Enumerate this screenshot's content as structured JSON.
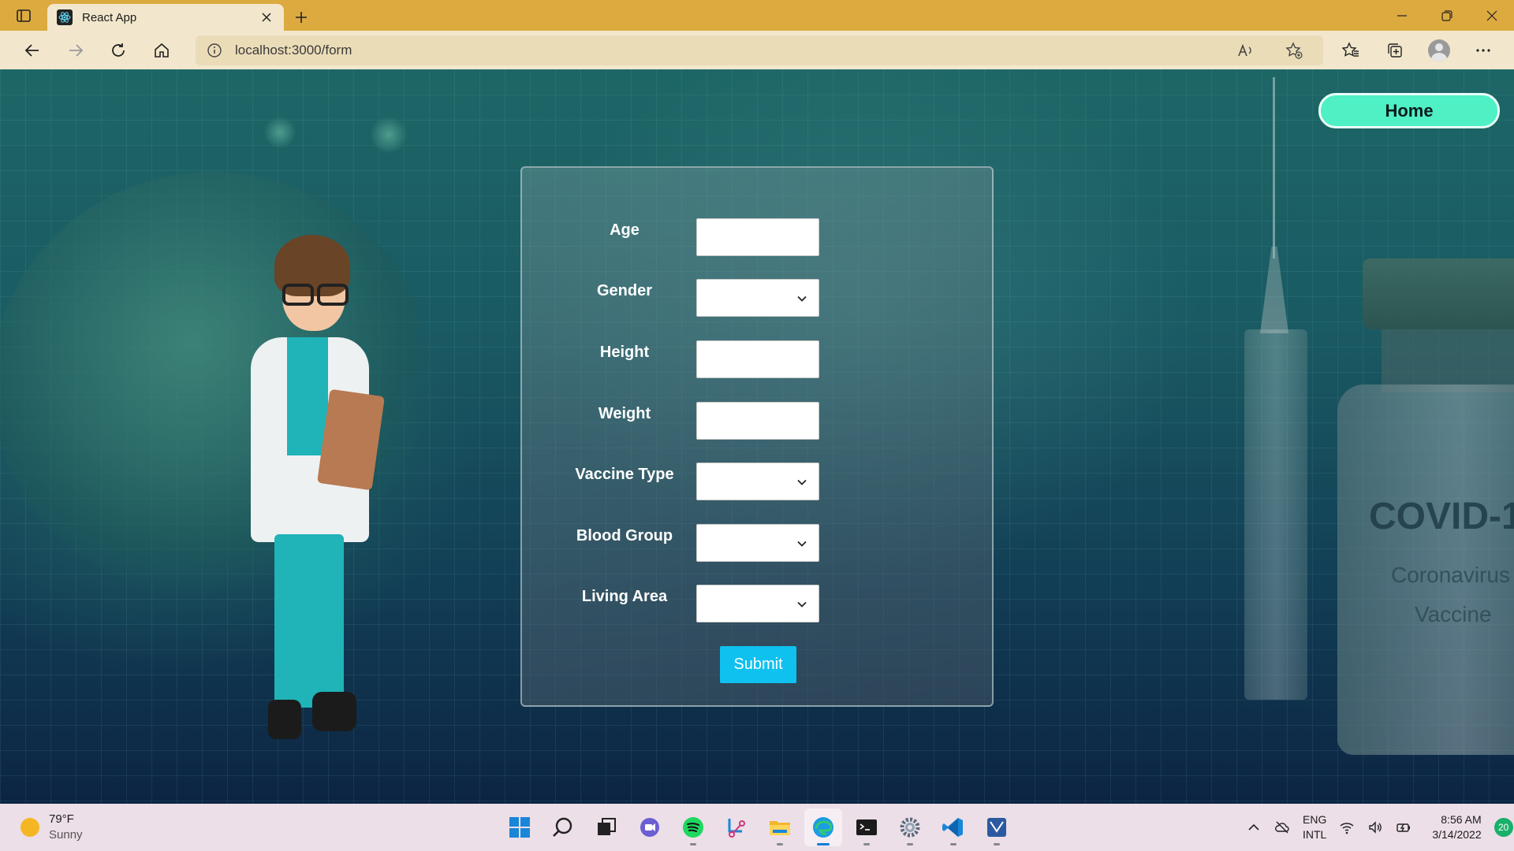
{
  "browser": {
    "tab_title": "React App",
    "url": "localhost:3000/form"
  },
  "page": {
    "home_label": "Home"
  },
  "form": {
    "fields": [
      {
        "label": "Age",
        "type": "text",
        "value": ""
      },
      {
        "label": "Gender",
        "type": "select",
        "value": ""
      },
      {
        "label": "Height",
        "type": "text",
        "value": ""
      },
      {
        "label": "Weight",
        "type": "text",
        "value": ""
      },
      {
        "label": "Vaccine Type",
        "type": "select",
        "value": ""
      },
      {
        "label": "Blood Group",
        "type": "select",
        "value": ""
      },
      {
        "label": "Living Area",
        "type": "select",
        "value": ""
      }
    ],
    "submit_label": "Submit"
  },
  "background": {
    "vial_title": "COVID-1",
    "vial_sub1": "Coronavirus",
    "vial_sub2": "Vaccine"
  },
  "taskbar": {
    "weather_temp": "79°F",
    "weather_condition": "Sunny",
    "lang_primary": "ENG",
    "lang_secondary": "INTL",
    "time": "8:56 AM",
    "date": "3/14/2022",
    "notification_count": "20",
    "apps": [
      "windows-start-icon",
      "search-icon",
      "task-view-icon",
      "teams-chat-icon",
      "spotify-icon",
      "snipping-tool-icon",
      "file-explorer-icon",
      "edge-icon",
      "terminal-icon",
      "settings-icon",
      "vscode-icon",
      "app-icon"
    ]
  },
  "colors": {
    "titlebar": "#dcaa3f",
    "home_button": "#4ef0c4",
    "submit_button": "#0fc1ef"
  }
}
